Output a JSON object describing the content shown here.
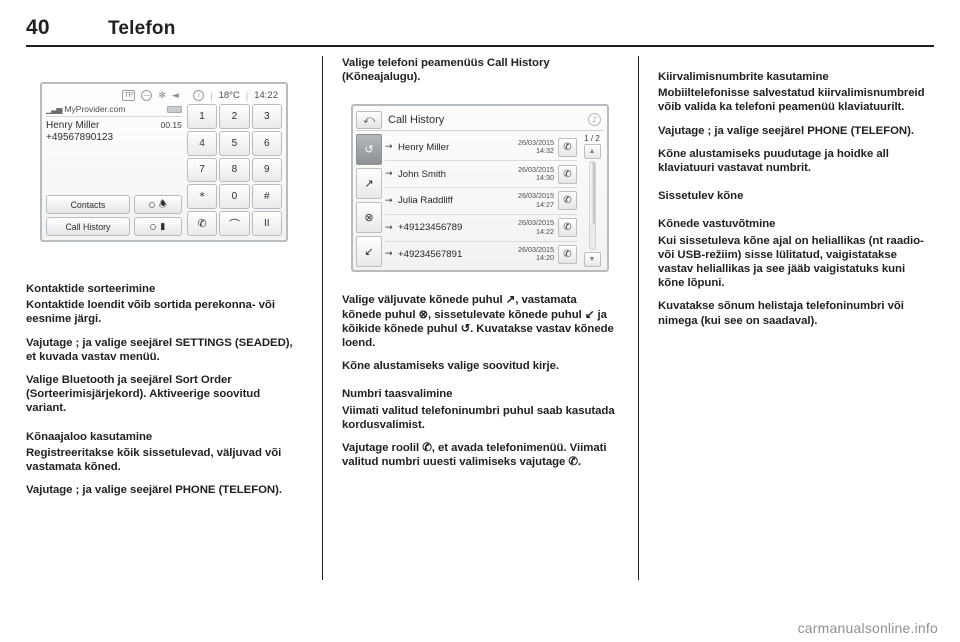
{
  "header": {
    "page_number": "40",
    "title": "Telefon"
  },
  "footer": {
    "watermark": "carmanualsonline.info"
  },
  "screen_phone": {
    "status_bar": {
      "tp": "TP",
      "no_entry_icon": "no-entry-icon",
      "bluetooth_icon": "✻",
      "mute_icon": "◄",
      "media_icon": "♪",
      "temperature": "18°C",
      "clock": "14:22"
    },
    "provider": "MyProvider.com",
    "caller_name": "Henry Miller",
    "call_duration": "00.15",
    "caller_number": "+49567890123",
    "buttons": {
      "contacts": "Contacts",
      "call_history": "Call History",
      "mute_mic": "mic-muted-icon",
      "speaker": "handset-transfer-icon"
    },
    "keypad": [
      "1",
      "2",
      "3",
      "4",
      "5",
      "6",
      "7",
      "8",
      "9",
      "*",
      "0",
      "#"
    ],
    "star_secondary": "+",
    "action_keys": {
      "dial": "✆",
      "hangup": "hangup-icon",
      "hold": "II"
    }
  },
  "screen_call_history": {
    "back_icon": "back-arrow-icon",
    "title": "Call History",
    "note_icon": "♪",
    "tabs": [
      {
        "name": "all-calls-tab",
        "glyph": "↺",
        "active": true
      },
      {
        "name": "outgoing-calls-tab",
        "glyph": "↗",
        "active": false
      },
      {
        "name": "missed-calls-tab",
        "glyph": "⊗",
        "active": false
      },
      {
        "name": "incoming-calls-tab",
        "glyph": "↙",
        "active": false
      }
    ],
    "rows": [
      {
        "arrow": "→",
        "label": "Henry Miller",
        "date": "26/03/2015",
        "time": "14:32"
      },
      {
        "arrow": "→",
        "label": "John Smith",
        "date": "26/03/2015",
        "time": "14:30"
      },
      {
        "arrow": "→",
        "label": "Julia Raddliff",
        "date": "26/03/2015",
        "time": "14:27"
      },
      {
        "arrow": "→",
        "label": "+49123456789",
        "date": "26/03/2015",
        "time": "14:22"
      },
      {
        "arrow": "→",
        "label": "+49234567891",
        "date": "26/03/2015",
        "time": "14:20"
      }
    ],
    "page_indicator": "1 / 2",
    "scroll_up": "▲",
    "scroll_down": "▼",
    "call_icon": "✆"
  },
  "column1": {
    "heading_contacts": "Kontaktide sorteerimine",
    "p1": "Kontaktide loendit võib sortida perekonna- või eesnime järgi.",
    "p2": "Vajutage ; ja valige seejärel SETTINGS (SEADED), et kuvada vastav menüü.",
    "p3": "Valige Bluetooth ja seejärel Sort Order (Sorteerimisjärjekord). Aktiveerige soovitud variant.",
    "heading_history": "Kõnaajaloo kasutamine",
    "p4": "Registreeritakse kõik sissetulevad, väljuvad või vastamata kõned.",
    "p5": "Vajutage ; ja valige seejärel PHONE (TELEFON)."
  },
  "column2": {
    "p1": "Valige telefoni peamenüüs Call History (Kõneajalugu).",
    "p2": "Valige väljuvate kõnede puhul ↗, vastamata kõnede puhul ⊗, sissetulevate kõnede puhul ↙ ja kõikide kõnede puhul ↺. Kuvatakse vastav kõnede loend.",
    "p3": "Kõne alustamiseks valige soovitud kirje.",
    "heading_redial": "Numbri taasvalimine",
    "p4": "Viimati valitud telefoninumbri puhul saab kasutada kordusvalimist.",
    "p5": "Vajutage roolil ✆, et avada telefonimenüü. Viimati valitud numbri uuesti valimiseks vajutage ✆."
  },
  "column3": {
    "heading_speeddial": "Kiirvalimisnumbrite kasutamine",
    "p1": "Mobiiltelefonisse salvestatud kiirvalimisnumbreid võib valida ka telefoni peamenüü klaviatuurilt.",
    "p2": "Vajutage ; ja valige seejärel PHONE (TELEFON).",
    "p3": "Kõne alustamiseks puudutage ja hoidke all klaviatuuri vastavat numbrit.",
    "heading_incoming": "Sissetulev kõne",
    "heading_answer": "Kõnede vastuvõtmine",
    "p4": "Kui sissetuleva kõne ajal on heliallikas (nt raadio- või USB-režiim) sisse lülitatud, vaigistatakse vastav heliallikas ja see jääb vaigistatuks kuni kõne lõpuni.",
    "p5": "Kuvatakse sõnum helistaja telefoninumbri või nimega (kui see on saadaval)."
  }
}
